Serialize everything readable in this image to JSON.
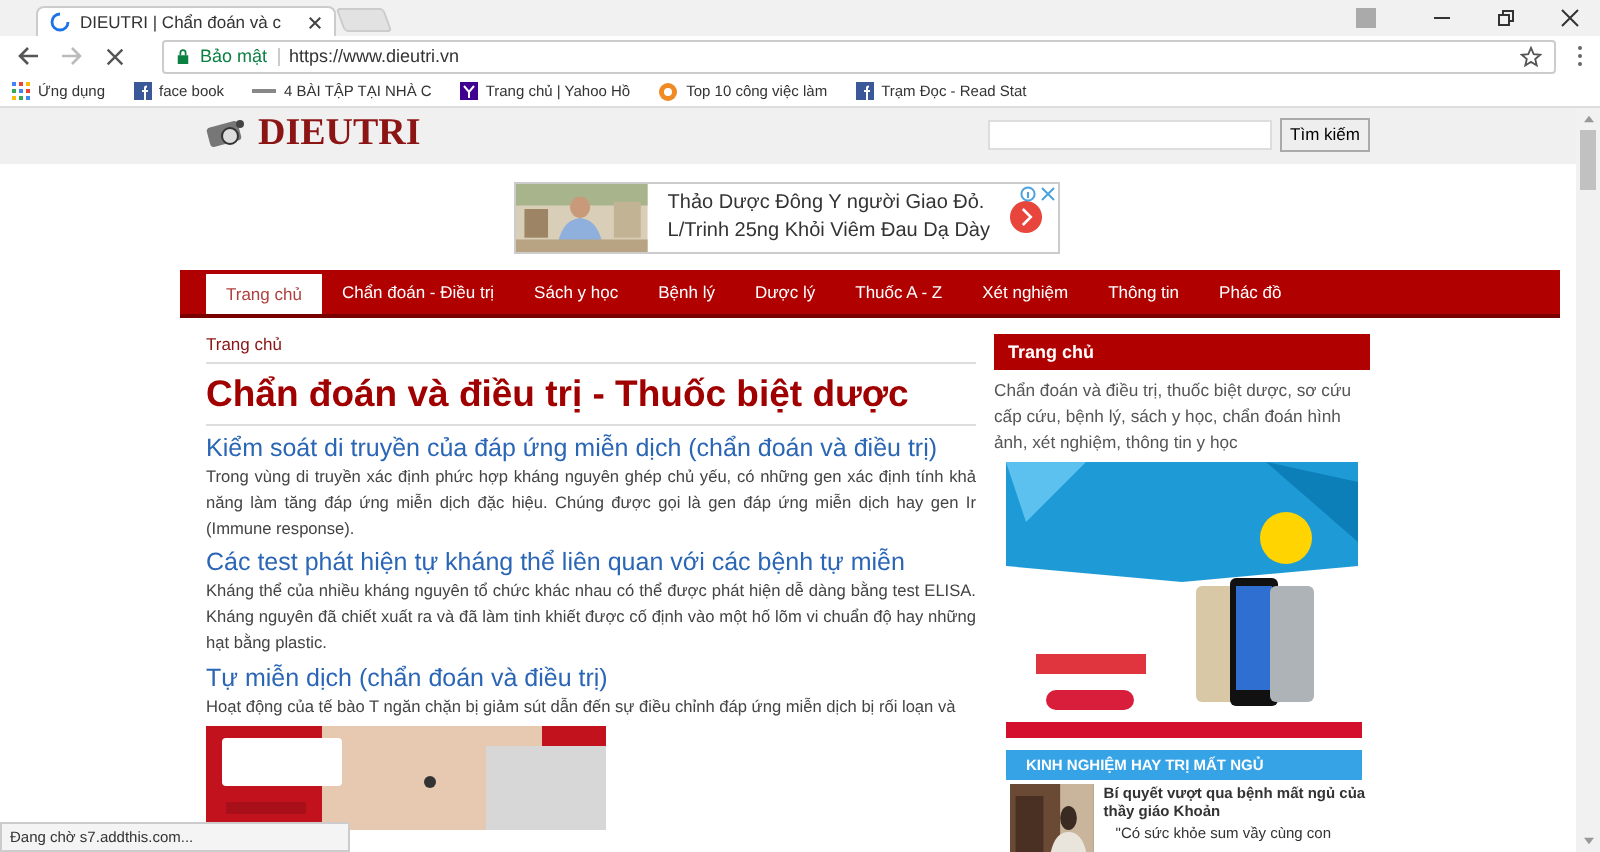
{
  "browser": {
    "tab_title": "DIEUTRI | Chẩn đoán và c",
    "security_label": "Bảo mật",
    "url": "https://www.dieutri.vn",
    "bookmarks": [
      {
        "label": "Ứng dụng",
        "kind": "apps"
      },
      {
        "label": "face book",
        "kind": "facebook"
      },
      {
        "label": "4 BÀI TẬP TẠI NHÀ C",
        "kind": "line"
      },
      {
        "label": "Trang chủ | Yahoo Hồ",
        "kind": "yahoo"
      },
      {
        "label": "Top 10 công việc làm",
        "kind": "sun"
      },
      {
        "label": "Trạm Đọc - Read Stat",
        "kind": "facebook"
      }
    ],
    "status": "Đang chờ s7.addthis.com..."
  },
  "site": {
    "logo": "DIEUTRI",
    "search_button": "Tìm kiếm"
  },
  "top_ad": {
    "line_1": "Thảo Dược Đông Y người Giao Đỏ.",
    "line_2": "L/Trinh 25ng Khỏi Viêm Đau Dạ Dày"
  },
  "nav": [
    {
      "label": "Trang chủ",
      "selected": true
    },
    {
      "label": "Chẩn đoán - Điều trị",
      "selected": false
    },
    {
      "label": "Sách y học",
      "selected": false
    },
    {
      "label": "Bệnh lý",
      "selected": false
    },
    {
      "label": "Dược lý",
      "selected": false
    },
    {
      "label": "Thuốc A - Z",
      "selected": false
    },
    {
      "label": "Xét nghiệm",
      "selected": false
    },
    {
      "label": "Thông tin",
      "selected": false
    },
    {
      "label": "Phác đồ",
      "selected": false
    }
  ],
  "breadcrumb": "Trang chủ",
  "heading": "Chẩn đoán và điều trị - Thuốc biệt dược",
  "articles": [
    {
      "title": "Kiểm soát di truyền của đáp ứng miễn dịch (chẩn đoán và điều trị)",
      "summary": "Trong vùng di truyền xác định phức hợp kháng nguyên ghép chủ yếu, có những gen xác định tính khả năng làm tăng đáp ứng miễn dịch đặc hiệu. Chúng được gọi là gen đáp ứng miễn dịch hay gen Ir (Immune response)."
    },
    {
      "title": "Các test phát hiện tự kháng thể liên quan với các bệnh tự miễn",
      "summary": "Kháng thể của nhiều kháng nguyên tổ chức khác nhau có thể được phát hiện dễ dàng bằng test ELISA. Kháng nguyên đã chiết xuất ra và đã làm tinh khiết được cố định vào một hố lõm vi chuẩn độ hay những hạt bằng plastic."
    },
    {
      "title": "Tự miễn dịch (chẩn đoán và điều trị)",
      "summary": "Hoạt động của tế bào T ngăn chặn bị giảm sút dẫn đến sự điều chỉnh đáp ứng miễn dịch bị rối loạn và"
    }
  ],
  "sidebar": {
    "heading": "Trang chủ",
    "text": "Chẩn đoán và điều trị, thuốc biệt dược, sơ cứu cấp cứu, bệnh lý, sách y học, chẩn đoán hình ảnh, xét nghiệm, thông tin y học",
    "promo": {
      "heading": "KINH NGHIỆM HAY TRỊ MẤT NGỦ",
      "title": "Bí quyết vượt qua bệnh mất ngủ của thầy giáo Khoản",
      "quote": "\"Có sức khỏe sum vầy cùng con"
    }
  }
}
